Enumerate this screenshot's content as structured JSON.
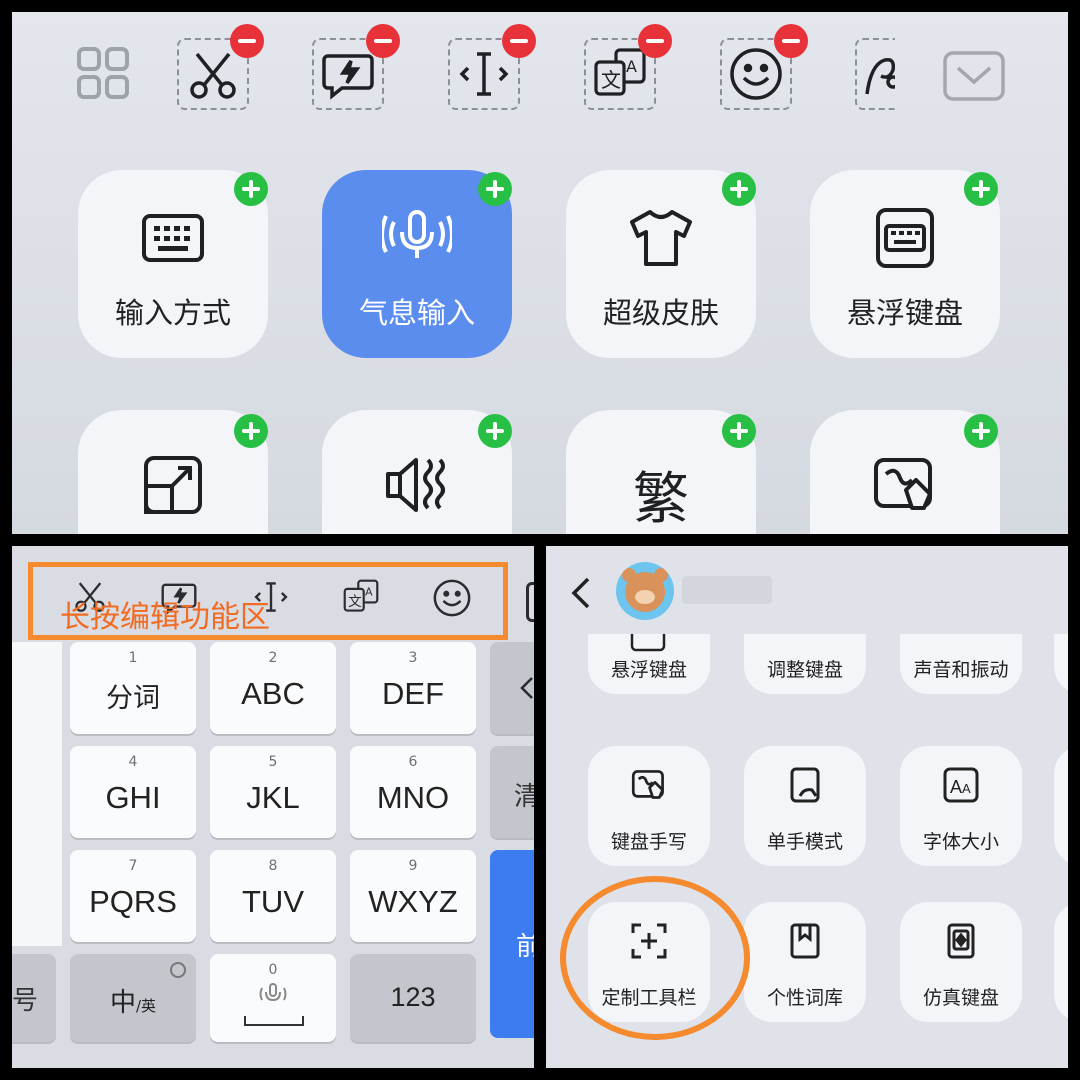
{
  "top_panel": {
    "toolbar_icons": [
      "cut-icon",
      "quick-phrase-icon",
      "cursor-icon",
      "translate-icon",
      "emoji-icon",
      "handwriting-icon"
    ],
    "grid_icon": "grid-icon",
    "collapse_icon": "collapse-keyboard-icon",
    "tiles": [
      {
        "label": "输入方式",
        "icon": "keyboard-icon",
        "active": false
      },
      {
        "label": "气息输入",
        "icon": "voice-breath-icon",
        "active": true
      },
      {
        "label": "超级皮肤",
        "icon": "shirt-icon",
        "active": false
      },
      {
        "label": "悬浮键盘",
        "icon": "floating-keyboard-icon",
        "active": false
      },
      {
        "label": "",
        "icon": "resize-icon",
        "active": false
      },
      {
        "label": "",
        "icon": "sound-vibration-icon",
        "active": false
      },
      {
        "label": "繁",
        "icon": "traditional-chinese-icon",
        "active": false
      },
      {
        "label": "",
        "icon": "handwriting-pad-icon",
        "active": false
      }
    ]
  },
  "bottom_left": {
    "annotation": "长按编辑功能区",
    "keys": [
      {
        "num": "1",
        "label": "分词"
      },
      {
        "num": "2",
        "label": "ABC"
      },
      {
        "num": "3",
        "label": "DEF"
      },
      {
        "num": "4",
        "label": "GHI"
      },
      {
        "num": "5",
        "label": "JKL"
      },
      {
        "num": "6",
        "label": "MNO"
      },
      {
        "num": "7",
        "label": "PQRS"
      },
      {
        "num": "8",
        "label": "TUV"
      },
      {
        "num": "9",
        "label": "WXYZ"
      }
    ],
    "side_labels": {
      "clear": "清",
      "symbol": "号",
      "next": "前"
    },
    "bottom_row": {
      "lang_main": "中",
      "lang_sub": "/英",
      "space_num": "0",
      "num_key": "123"
    }
  },
  "bottom_right": {
    "items": [
      {
        "label": "悬浮键盘",
        "icon": "floating-keyboard-icon"
      },
      {
        "label": "调整键盘",
        "icon": "adjust-keyboard-icon"
      },
      {
        "label": "声音和振动",
        "icon": "sound-vibration-icon"
      },
      {
        "label": "键盘手写",
        "icon": "handwriting-pad-icon"
      },
      {
        "label": "单手模式",
        "icon": "one-hand-icon"
      },
      {
        "label": "字体大小",
        "icon": "font-size-icon"
      },
      {
        "label": "定制工具栏",
        "icon": "customize-toolbar-icon"
      },
      {
        "label": "个性词库",
        "icon": "dictionary-icon"
      },
      {
        "label": "仿真键盘",
        "icon": "realistic-keyboard-icon"
      }
    ],
    "highlighted": "定制工具栏"
  },
  "colors": {
    "accent_blue": "#5b8def",
    "add_green": "#27c045",
    "remove_red": "#e8323a",
    "annotation_orange": "#f58a2e"
  }
}
